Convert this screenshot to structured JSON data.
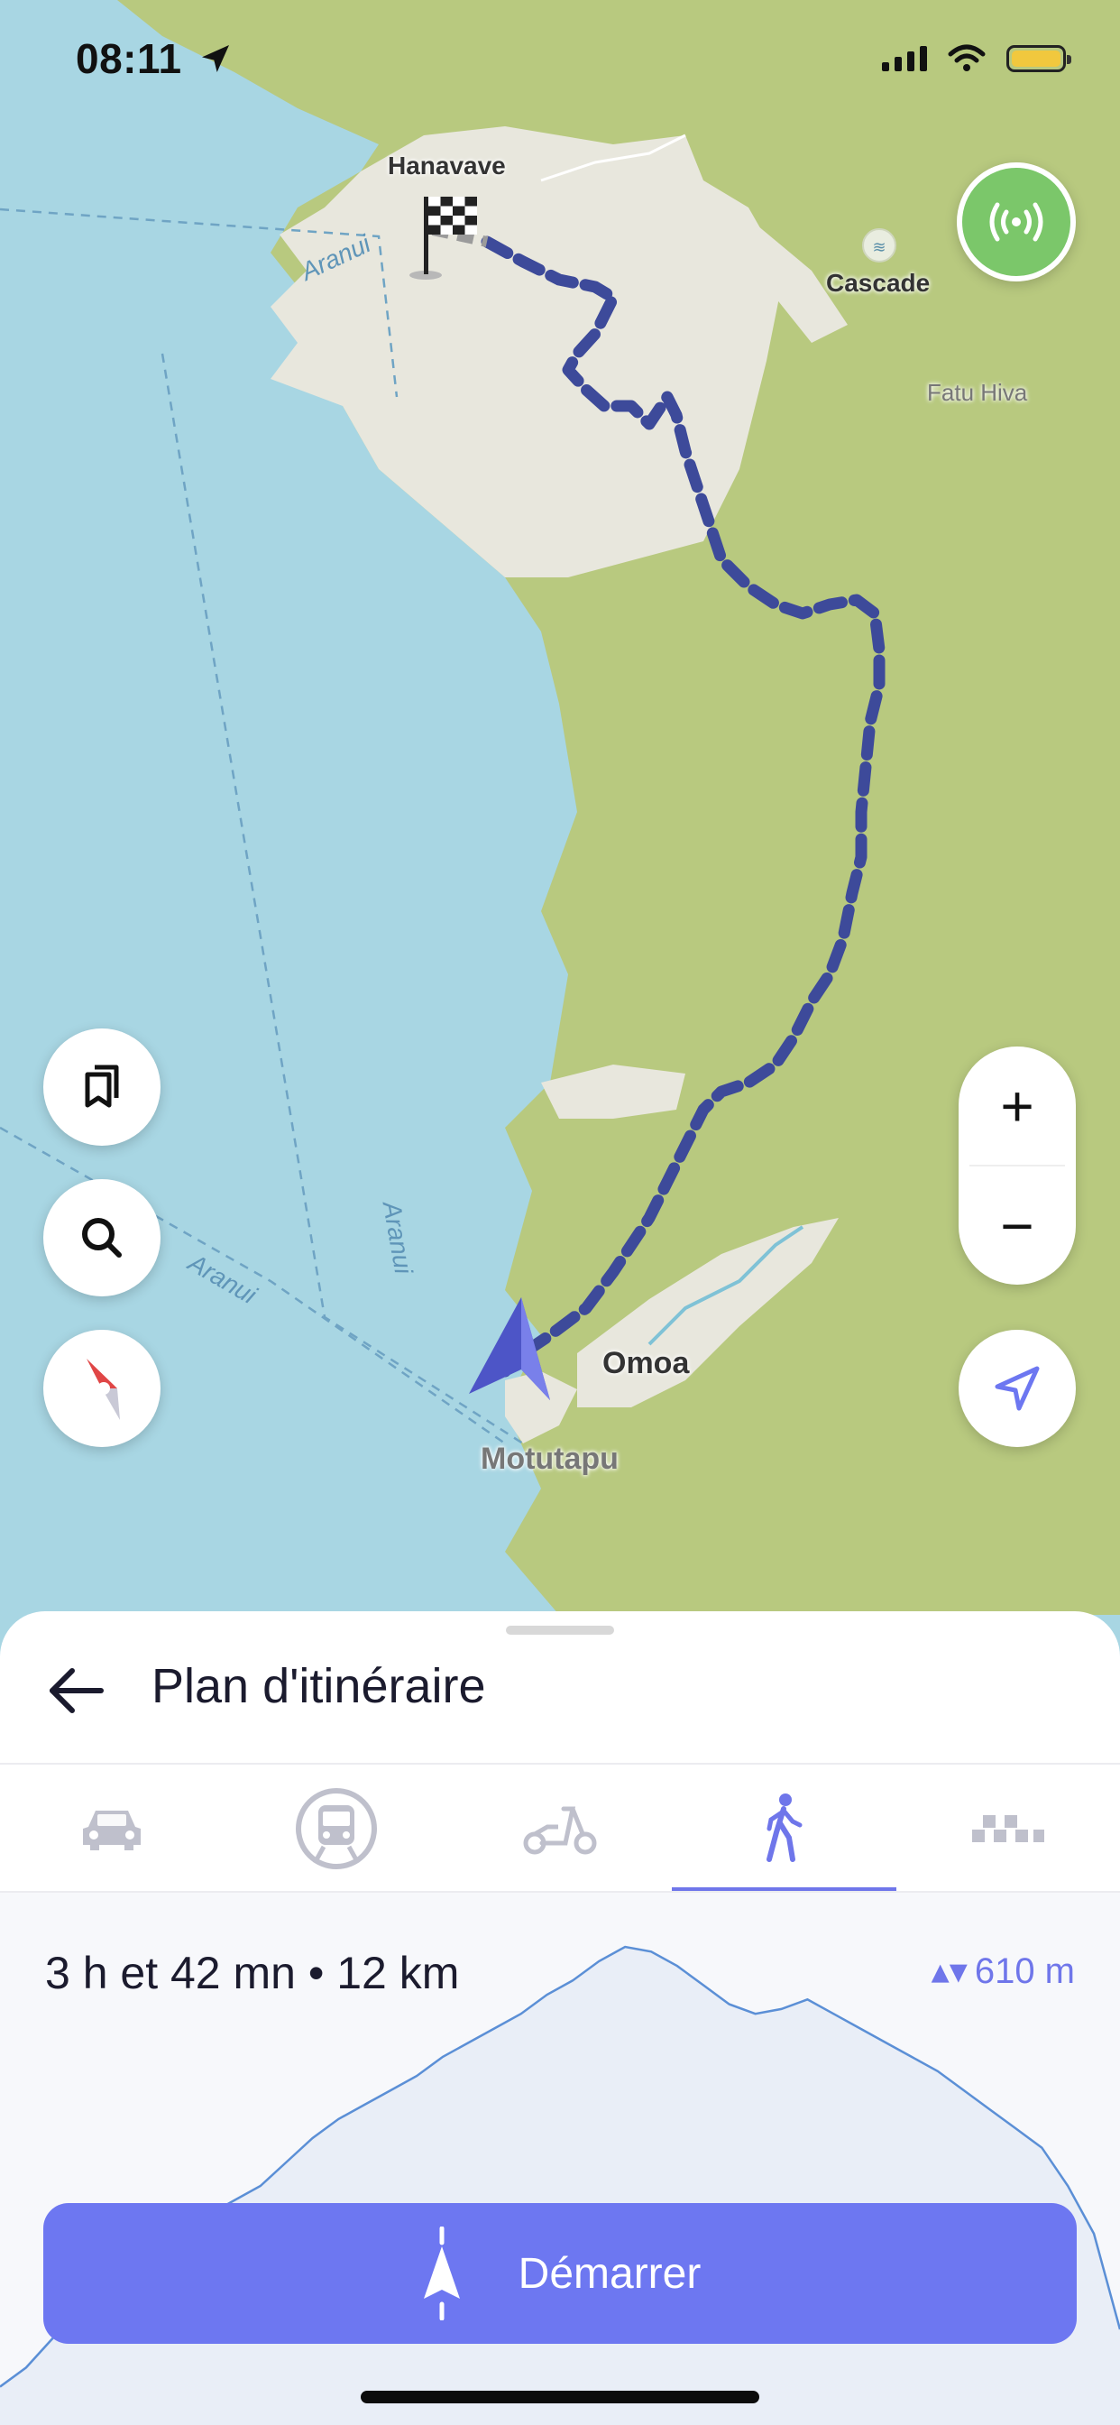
{
  "status_bar": {
    "time": "08:11"
  },
  "map": {
    "places": {
      "start_village": "Hanavave",
      "waterfall": "Cascade",
      "island": "Fatu Hiva",
      "end_village": "Omoa",
      "point": "Motutapu"
    },
    "sea_route_labels": [
      "Aranui",
      "Aranui",
      "Aranui"
    ],
    "icons": {
      "bookmarks": "bookmarks-icon",
      "search": "search-icon",
      "compass": "compass-icon",
      "locate": "locate-arrow-icon",
      "live_signal": "broadcast-signal-icon",
      "finish": "checkered-flag-icon",
      "position": "navigation-arrow-icon"
    },
    "zoom_in": "+",
    "zoom_out": "−"
  },
  "sheet": {
    "title": "Plan d'itinéraire",
    "transport_tabs": [
      "car",
      "transit",
      "scooter",
      "walk",
      "taxi"
    ],
    "active_tab": "walk",
    "route_summary": "3 h et 42 mn • 12 km",
    "elevation_gain": "610 m",
    "start_button": "Démarrer",
    "elevation_profile": [
      0.08,
      0.12,
      0.18,
      0.24,
      0.29,
      0.33,
      0.36,
      0.4,
      0.44,
      0.47,
      0.5,
      0.55,
      0.6,
      0.64,
      0.67,
      0.7,
      0.73,
      0.77,
      0.8,
      0.83,
      0.86,
      0.9,
      0.93,
      0.97,
      1.0,
      0.99,
      0.96,
      0.92,
      0.88,
      0.86,
      0.87,
      0.89,
      0.86,
      0.83,
      0.8,
      0.77,
      0.74,
      0.7,
      0.66,
      0.62,
      0.58,
      0.5,
      0.4,
      0.2
    ]
  },
  "colors": {
    "sea": "#a8d6e3",
    "land": "#b8c97f",
    "sand": "#e8e7dd",
    "route": "#3d4a9a",
    "accent": "#6d77f1",
    "live_green": "#7bc76a"
  }
}
